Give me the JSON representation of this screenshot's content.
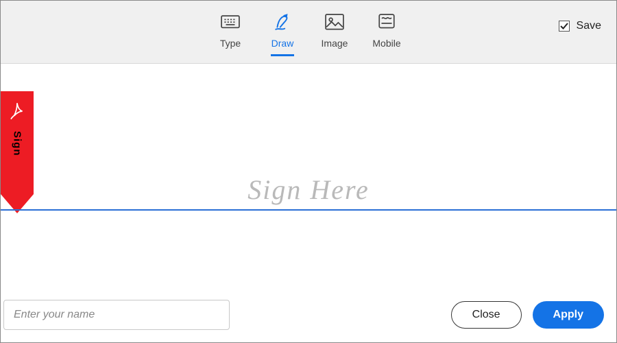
{
  "toolbar": {
    "tabs": [
      {
        "label": "Type",
        "name": "tab-type",
        "active": false,
        "icon": "keyboard-icon"
      },
      {
        "label": "Draw",
        "name": "tab-draw",
        "active": true,
        "icon": "pen-icon"
      },
      {
        "label": "Image",
        "name": "tab-image",
        "active": false,
        "icon": "image-icon"
      },
      {
        "label": "Mobile",
        "name": "tab-mobile",
        "active": false,
        "icon": "mobile-icon"
      }
    ],
    "save": {
      "label": "Save",
      "checked": true
    }
  },
  "flag": {
    "label": "Sign"
  },
  "canvas": {
    "placeholder": "Sign Here"
  },
  "footer": {
    "name_placeholder": "Enter your name",
    "close_label": "Close",
    "apply_label": "Apply"
  },
  "colors": {
    "accent": "#1473e6",
    "flag": "#ed1c24",
    "line": "#2a6fd6"
  }
}
